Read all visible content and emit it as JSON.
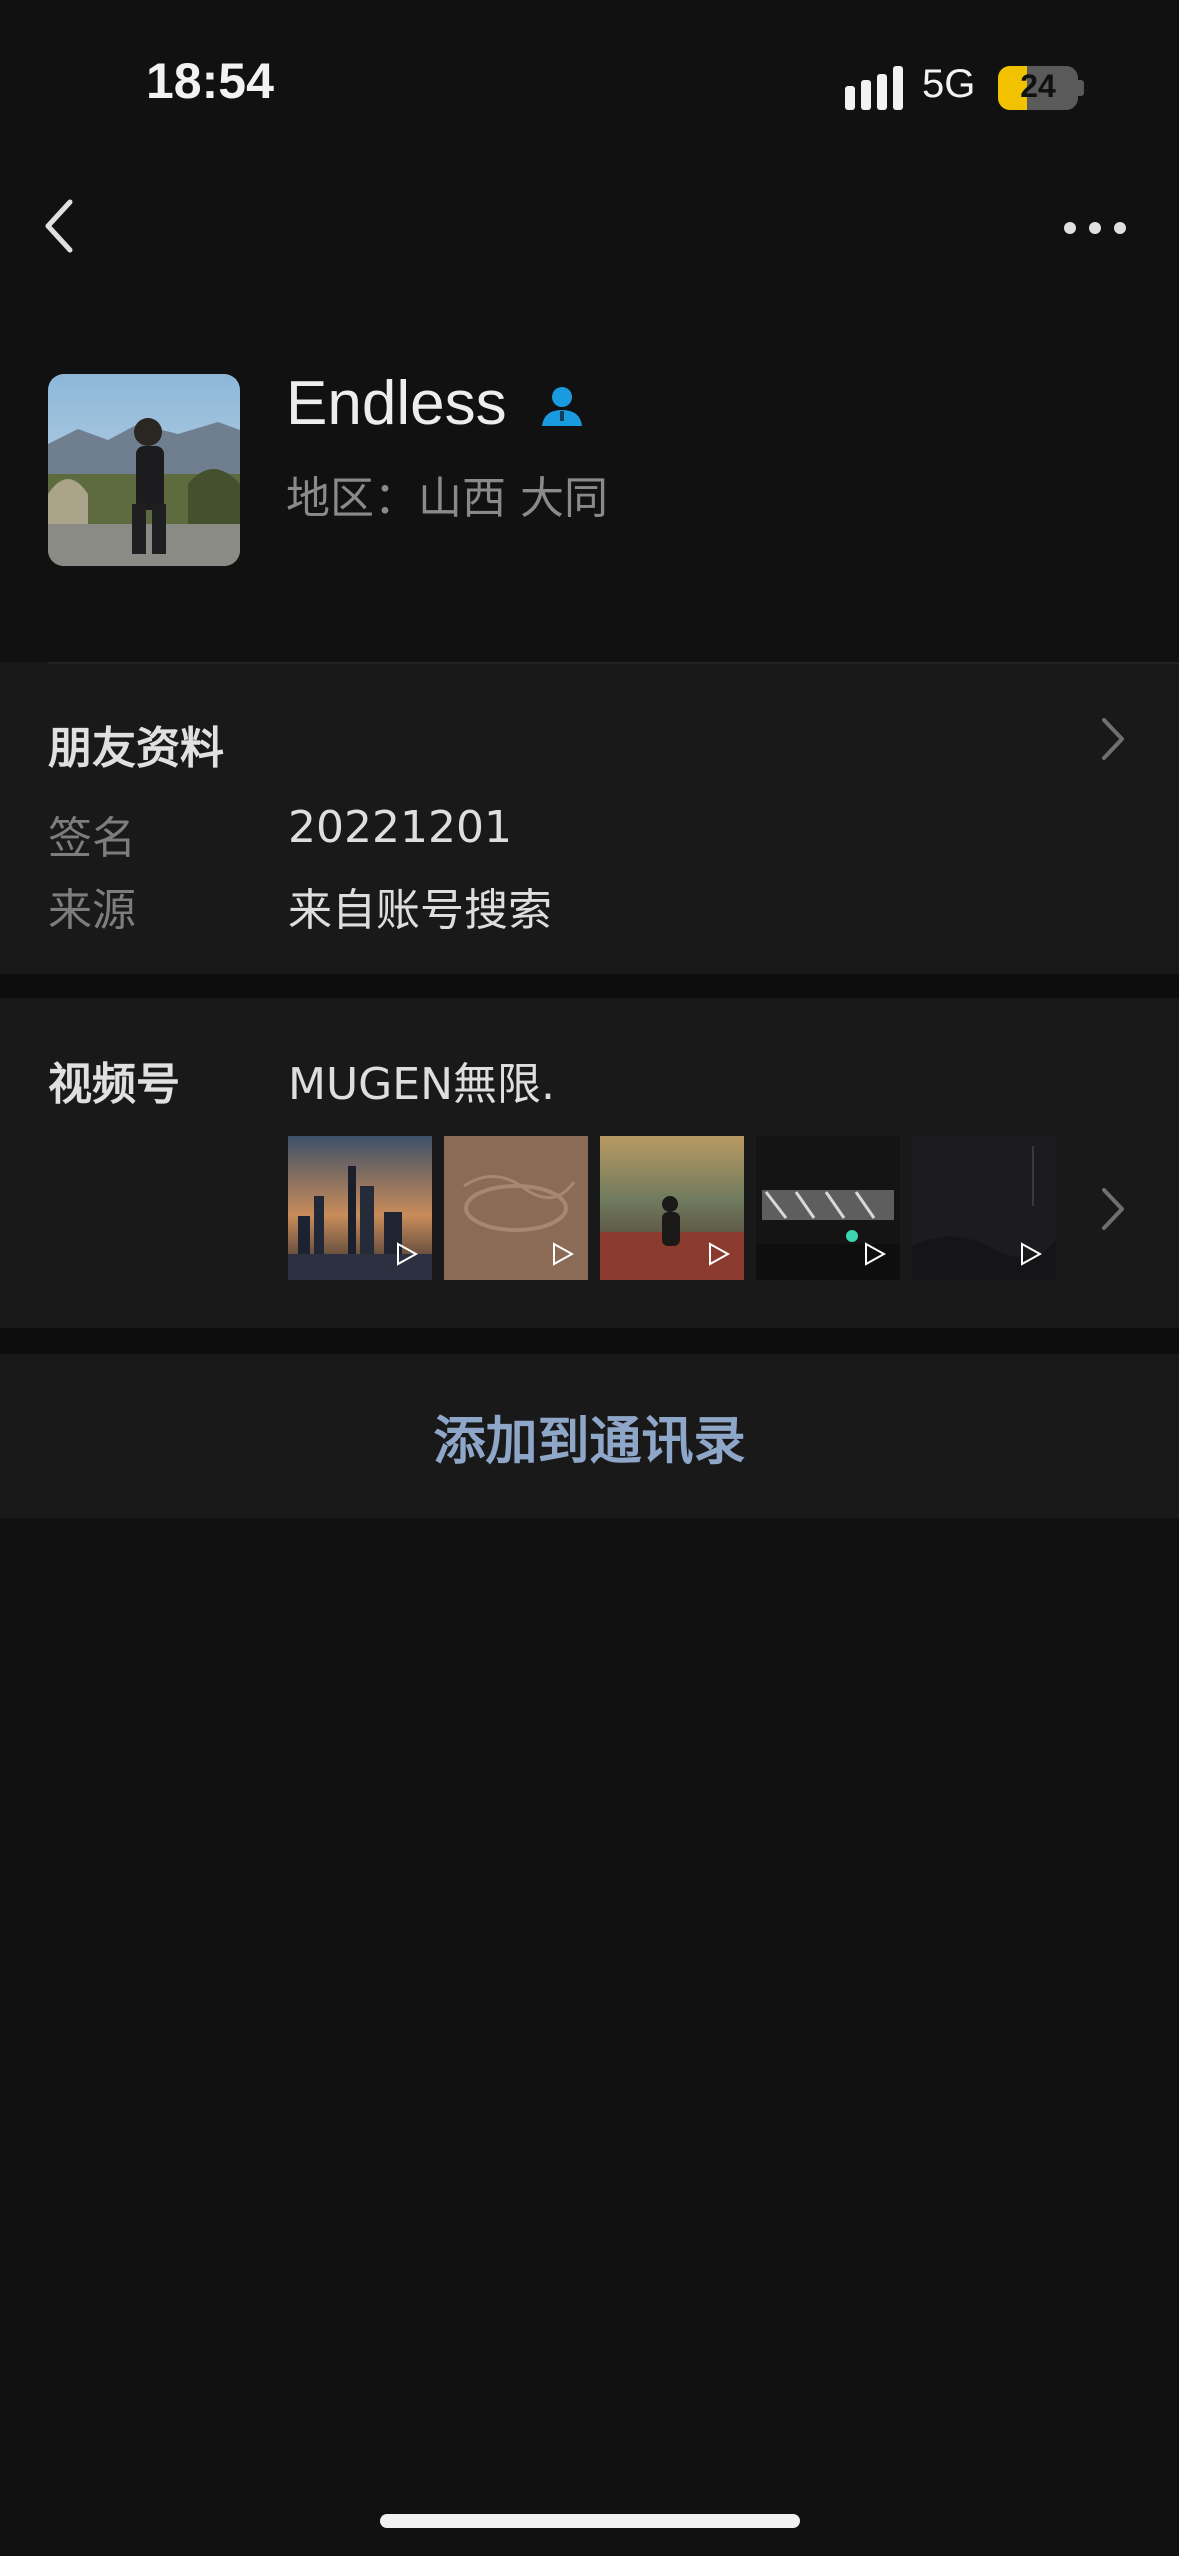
{
  "status_bar": {
    "time": "18:54",
    "network": "5G",
    "battery": "24",
    "battery_level": 0.24
  },
  "profile": {
    "name": "Endless",
    "region": "地区：山西 大同"
  },
  "friend_info": {
    "title": "朋友资料",
    "rows": [
      {
        "label": "签名",
        "value": "20221201"
      },
      {
        "label": "来源",
        "value": "来自账号搜索"
      }
    ]
  },
  "channels": {
    "label": "视频号",
    "name": "MUGEN無限."
  },
  "actions": {
    "add_contact": "添加到通讯录"
  },
  "colors": {
    "accent_link": "#8ea6c7",
    "contact_icon": "#1a9be0",
    "battery_fill": "#f2c200"
  },
  "icons": [
    "signal-icon",
    "battery-icon",
    "back-arrow-icon",
    "more-dots-icon",
    "contact-badge-icon",
    "chevron-right-icon",
    "play-icon"
  ]
}
